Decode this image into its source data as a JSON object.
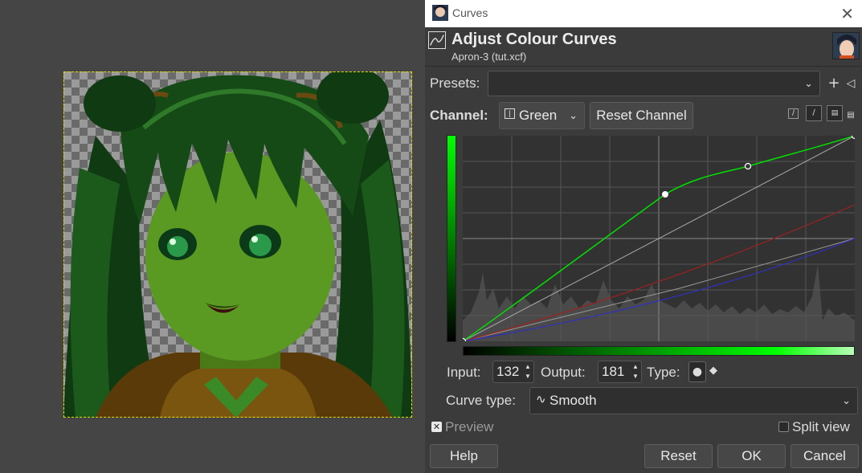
{
  "window": {
    "title": "Curves"
  },
  "header": {
    "title": "Adjust Colour Curves",
    "subtitle": "Apron-3 (tut.xcf)"
  },
  "presets": {
    "label": "Presets:",
    "value": ""
  },
  "channel": {
    "label": "Channel:",
    "value": "Green",
    "reset_label": "Reset Channel"
  },
  "point": {
    "input_label": "Input:",
    "input_value": "132",
    "output_label": "Output:",
    "output_value": "181",
    "type_label": "Type:"
  },
  "curve_type": {
    "label": "Curve type:",
    "value": "Smooth"
  },
  "preview": {
    "label": "Preview",
    "checked": true
  },
  "split_view": {
    "label": "Split view",
    "checked": false
  },
  "buttons": {
    "help": "Help",
    "reset": "Reset",
    "ok": "OK",
    "cancel": "Cancel"
  },
  "colors": {
    "green_curve": "#00e000",
    "red_curve": "#a02020",
    "blue_curve": "#3030c0",
    "value_curve": "#aaaaaa"
  }
}
